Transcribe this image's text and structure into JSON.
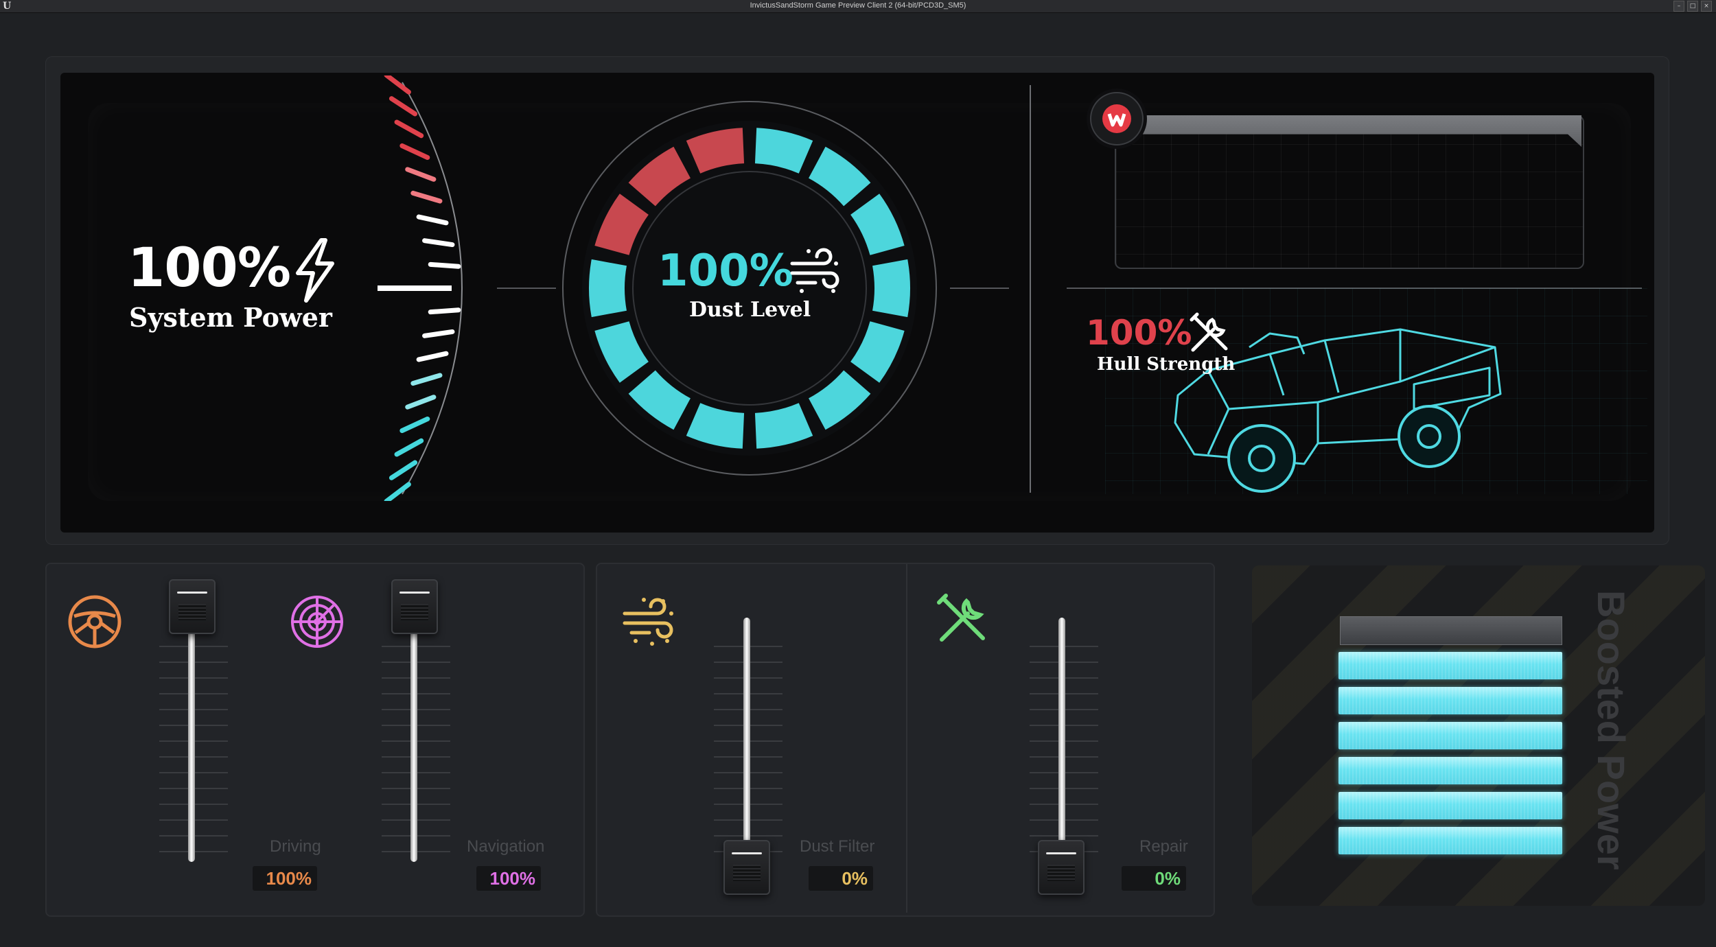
{
  "window": {
    "title": "InvictusSandStorm Game Preview Client 2 (64-bit/PCD3D_SM5)"
  },
  "system_power": {
    "value": "100%",
    "label": "System Power",
    "icon": "lightning-bolt-icon",
    "gauge_level": 1.0
  },
  "dust": {
    "value": "100%",
    "label": "Dust Level",
    "icon": "wind-dust-icon",
    "ring_level": 1.0
  },
  "hull": {
    "value": "100%",
    "label": "Hull Strength",
    "icon": "wrench-screwdriver-icon"
  },
  "sliders": [
    {
      "id": "driving",
      "label": "Driving",
      "value": "100%",
      "level": 1.0,
      "icon": "steering-wheel-icon",
      "color": "#e8894a"
    },
    {
      "id": "navigation",
      "label": "Navigation",
      "value": "100%",
      "level": 1.0,
      "icon": "radar-icon",
      "color": "#e070e6"
    },
    {
      "id": "dust-filter",
      "label": "Dust Filter",
      "value": "0%",
      "level": 0.0,
      "icon": "wind-dust-icon",
      "color": "#e8c060"
    },
    {
      "id": "repair",
      "label": "Repair",
      "value": "0%",
      "level": 0.0,
      "icon": "wrench-screwdriver-icon",
      "color": "#6fdc7a"
    }
  ],
  "boost": {
    "title": "Boosted Power",
    "segments_total": 7,
    "segments_filled": 6
  },
  "colors": {
    "accent_cyan": "#45d8dd",
    "accent_red": "#e0424c",
    "background": "#0a0a0b"
  }
}
